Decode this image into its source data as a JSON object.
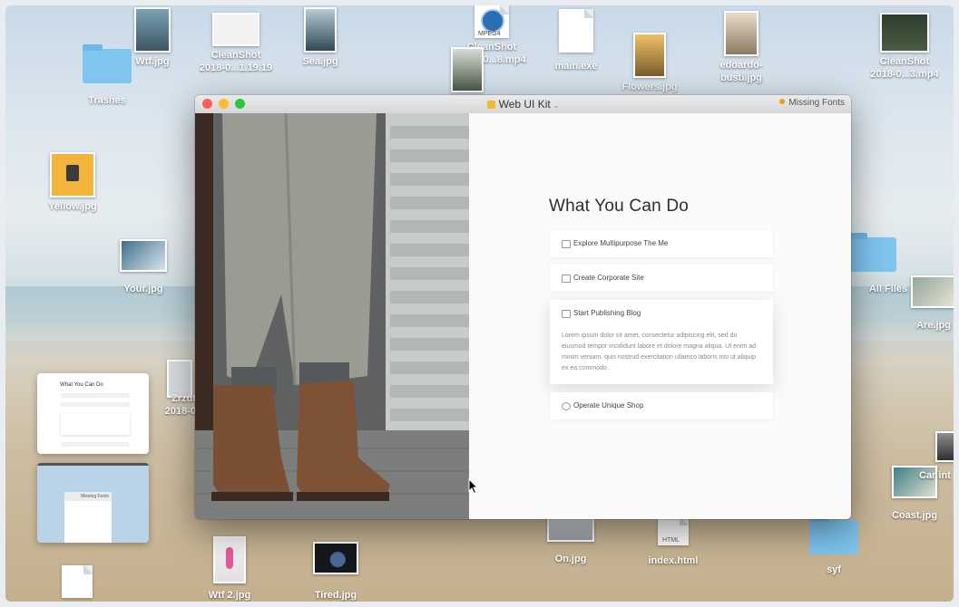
{
  "desktop": {
    "items": [
      {
        "label": "Wtf.jpg"
      },
      {
        "label": "CleanShot\n2018-0...1.19.19"
      },
      {
        "label": "Sea.jpg"
      },
      {
        "label": "CleanShot\n2018-0...8.mp4",
        "badge": "MPEG4"
      },
      {
        "label": "main.exe"
      },
      {
        "label": "Flowers.jpg"
      },
      {
        "label": "edoardo-\nbusti.jpg"
      },
      {
        "label": "CleanShot\n2018-0...3.mp4"
      },
      {
        "label": "Trashes"
      },
      {
        "label": "Yellow.jpg"
      },
      {
        "label": "Your.jpg"
      },
      {
        "label": "All Files"
      },
      {
        "label": "Are.jpg"
      },
      {
        "label": "Zrzut\n2018-0"
      },
      {
        "label": "Car int"
      },
      {
        "label": "Coast.jpg"
      },
      {
        "label": "On.jpg"
      },
      {
        "label": "index.html",
        "badge": "HTML"
      },
      {
        "label": "syf"
      },
      {
        "label": "Wtf 2.jpg"
      },
      {
        "label": "Tired.jpg"
      }
    ]
  },
  "window": {
    "title": "Web UI Kit",
    "chevron": "⌄",
    "missing_fonts": "Missing Fonts",
    "heading": "What You Can Do",
    "cards": [
      {
        "label": "Explore Multipurpose The Me"
      },
      {
        "label": "Create Corporate Site"
      },
      {
        "label": "Start Publishing Blog",
        "description": "Lorem ipsum dolor sit amet, consectetur adipiscing elit, sed do eiusmod tempor incididunt labore et dolore magna aliqua. Ut enim ad minim veniam, quis nostrud exercitation ullamco laboris nisi ut aliquip ex ea commodo ."
      },
      {
        "label": "Operate Unique Shop"
      }
    ]
  },
  "mini_preview": {
    "heading": "What You Can Do",
    "missing_fonts": "Missing Fonts"
  },
  "colors": {
    "close": "#fc5f57",
    "minimize": "#fdbc2e",
    "zoom": "#28c840",
    "missing_dot": "#f39c12",
    "app_icon": "#f5b631"
  }
}
